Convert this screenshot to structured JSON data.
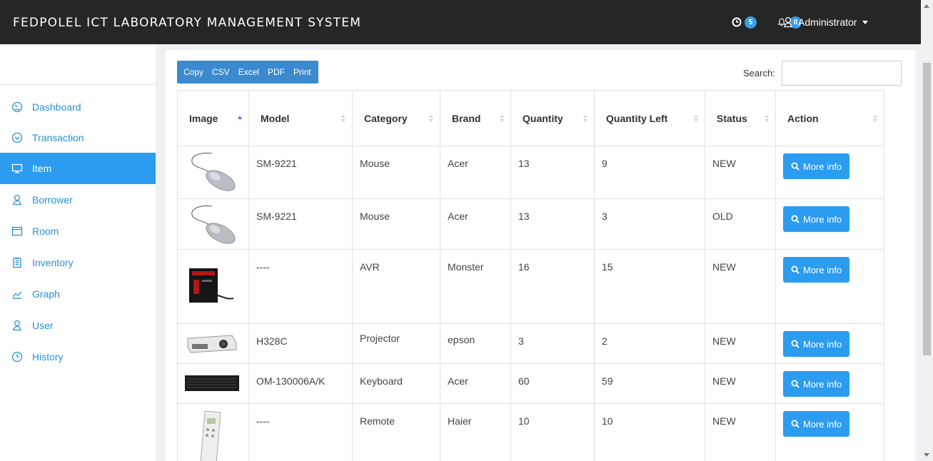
{
  "app": {
    "title": "FEDPOLEL ICT LABORATORY MANAGEMENT SYSTEM",
    "clock_badge": "5",
    "bell_badge": "0",
    "user": "Administrator"
  },
  "sidebar": {
    "items": [
      {
        "label": "Dashboard",
        "icon": "dashboard-icon"
      },
      {
        "label": "Transaction",
        "icon": "chevron-circle-icon"
      },
      {
        "label": "Item",
        "icon": "monitor-icon",
        "active": true
      },
      {
        "label": "Borrower",
        "icon": "user-icon"
      },
      {
        "label": "Room",
        "icon": "window-icon"
      },
      {
        "label": "Inventory",
        "icon": "clipboard-icon"
      },
      {
        "label": "Graph",
        "icon": "chart-icon"
      },
      {
        "label": "User",
        "icon": "user-icon"
      },
      {
        "label": "History",
        "icon": "clock-icon"
      }
    ]
  },
  "toolbar": {
    "copy": "Copy",
    "csv": "CSV",
    "excel": "Excel",
    "pdf": "PDF",
    "print": "Print",
    "search_label": "Search:",
    "search_value": ""
  },
  "table": {
    "headers": [
      "Image",
      "Model",
      "Category",
      "Brand",
      "Quantity",
      "Quantity Left",
      "Status",
      "Action"
    ],
    "action_label": "More info",
    "rows": [
      {
        "image": "mouse",
        "model": "SM-9221",
        "category": "Mouse",
        "brand": "Acer",
        "quantity": "13",
        "quantity_left": "9",
        "status": "NEW"
      },
      {
        "image": "mouse",
        "model": "SM-9221",
        "category": "Mouse",
        "brand": "Acer",
        "quantity": "13",
        "quantity_left": "3",
        "status": "OLD"
      },
      {
        "image": "avr",
        "model": "----",
        "category": "AVR",
        "brand": "Monster",
        "quantity": "16",
        "quantity_left": "15",
        "status": "NEW"
      },
      {
        "image": "projector",
        "model": "H328C",
        "category": "Projector",
        "brand": "epson",
        "quantity": "3",
        "quantity_left": "2",
        "status": "NEW"
      },
      {
        "image": "keyboard",
        "model": "OM-130006A/K",
        "category": "Keyboard",
        "brand": "Acer",
        "quantity": "60",
        "quantity_left": "59",
        "status": "NEW"
      },
      {
        "image": "remote",
        "model": "----",
        "category": "Remote",
        "brand": "Haier",
        "quantity": "10",
        "quantity_left": "10",
        "status": "NEW"
      }
    ]
  },
  "colors": {
    "navbar": "#262626",
    "accent": "#2b9cf0",
    "export_buttons": "#3b8ad0",
    "badge": "#3a9ee8"
  }
}
